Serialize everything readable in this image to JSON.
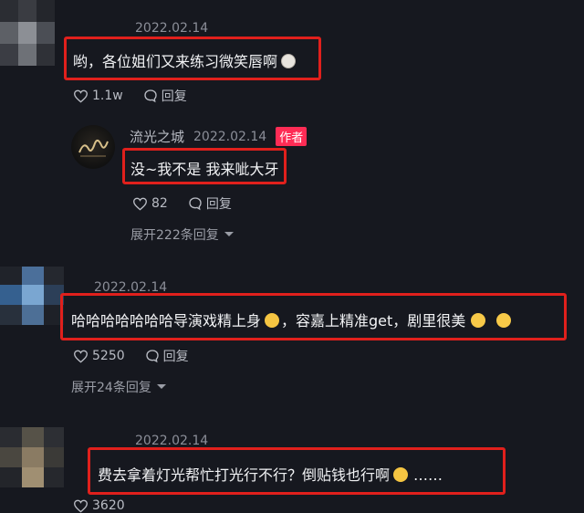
{
  "comments": [
    {
      "date": "2022.02.14",
      "text": "哟，各位姐们又来练习微笑唇啊",
      "emoji_icon": "cat-face-emoji",
      "likes": "1.1w",
      "reply_label": "回复",
      "reply": {
        "username": "流光之城",
        "date": "2022.02.14",
        "badge": "作者",
        "text": "没~我不是 我来呲大牙",
        "likes": "82",
        "reply_label": "回复",
        "expand_label": "展开222条回复"
      }
    },
    {
      "date": "2022.02.14",
      "text_part1": "哈哈哈哈哈哈哈导演戏精上身",
      "text_part2": "，容嘉上精准get，剧里很美",
      "emoji_icons": [
        "rolling-laughing-emoji",
        "pleading-face-emoji",
        "pleading-face-emoji"
      ],
      "likes": "5250",
      "reply_label": "回复",
      "expand_label": "展开24条回复"
    },
    {
      "date": "2022.02.14",
      "text_part1": "费去拿着灯光帮忙打光行不行？倒贴钱也行啊",
      "text_part2": "……",
      "emoji_icon": "grinning-sweat-emoji",
      "likes": "3620"
    }
  ],
  "colors": {
    "background": "#16181f",
    "highlight_box": "#e0201c",
    "author_badge": "#fe2c55"
  }
}
